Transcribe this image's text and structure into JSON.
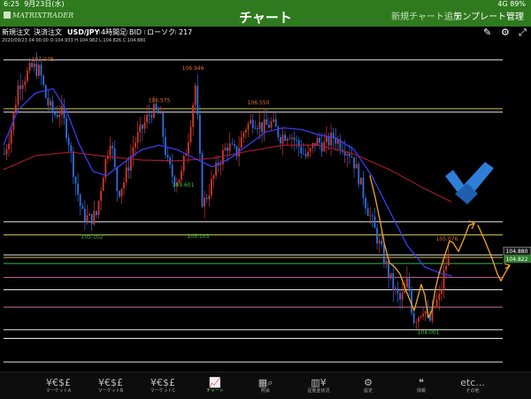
{
  "status_bar": {
    "time": "6:25",
    "date": "9月23日(水)",
    "right": "4G 89%"
  },
  "nav": {
    "logo": "MATRIXTRADER",
    "title": "チャート",
    "add_chart": "新規チャート追加",
    "template": "テンプレート管理"
  },
  "toolbar": {
    "new_order": "新規注文",
    "settle_order": "決済注文",
    "pair": "USD/JPY",
    "timeframe": "4時間足",
    "side": "BID",
    "chart_kind": "ローソク",
    "count": "217"
  },
  "ohlc_line": "2020/09/23 04:00:00   O:104.933  H:104.982  L:104.826  C:104.880",
  "tabs": [
    {
      "label": "マーケットA",
      "icon": "¥€$£"
    },
    {
      "label": "マーケットB",
      "icon": "¥€$£"
    },
    {
      "label": "マーケットC",
      "icon": "¥€$£"
    },
    {
      "label": "チャート",
      "icon": "chart"
    },
    {
      "label": "照会",
      "icon": "search"
    },
    {
      "label": "証拠金状況",
      "icon": "margin"
    },
    {
      "label": "設定",
      "icon": "gear"
    },
    {
      "label": "情報",
      "icon": "news"
    },
    {
      "label": "その他",
      "icon": "etc..."
    }
  ],
  "colors": {
    "up": "#d03a2c",
    "down": "#2f6fe0",
    "ma_short": "#3b3bf0",
    "ma_long": "#b01c2c",
    "hline_white": "#e6e6e6",
    "hline_yellow": "#c9c04a",
    "hline_pink": "#c46fa0",
    "price_tag": "#2e7d2e",
    "sketch": "#f2a71c",
    "annotation_blue": "#2f7fd8"
  },
  "chart_data": {
    "type": "candlestick",
    "symbol": "USD/JPY",
    "timeframe": "4時間足",
    "ylim": [
      103.55,
      107.25
    ],
    "high_low_labels": [
      {
        "text": "107.048",
        "x": 48,
        "price": 107.048
      },
      {
        "text": "106.946",
        "x": 218,
        "price": 106.946
      },
      {
        "text": "106.575",
        "x": 180,
        "price": 106.575
      },
      {
        "text": "106.550",
        "x": 292,
        "price": 106.55
      },
      {
        "text": "105.601",
        "x": 207,
        "price": 105.601
      },
      {
        "text": "105.102",
        "x": 104,
        "price": 105.102
      },
      {
        "text": "105.103",
        "x": 224,
        "price": 105.103
      },
      {
        "text": "105.076",
        "x": 505,
        "price": 105.076
      },
      {
        "text": "104.001",
        "x": 484,
        "price": 104.001
      }
    ],
    "current_price": "104.880",
    "bid_tag": "104.822",
    "horizontal_lines": [
      {
        "price": 107.08,
        "color": "white"
      },
      {
        "price": 106.52,
        "color": "yellow"
      },
      {
        "price": 106.48,
        "color": "white"
      },
      {
        "price": 105.22,
        "color": "white"
      },
      {
        "price": 105.07,
        "color": "yellow"
      },
      {
        "price": 104.84,
        "color": "white"
      },
      {
        "price": 104.81,
        "color": "yellow"
      },
      {
        "price": 104.74,
        "color": "green"
      },
      {
        "price": 104.58,
        "color": "pink"
      },
      {
        "price": 104.44,
        "color": "white"
      },
      {
        "price": 104.24,
        "color": "pink"
      },
      {
        "price": 103.98,
        "color": "white"
      },
      {
        "price": 103.88,
        "color": "white"
      },
      {
        "price": 103.61,
        "color": "white"
      }
    ],
    "candle_path": [
      [
        4,
        106.0
      ],
      [
        12,
        106.3
      ],
      [
        20,
        106.8
      ],
      [
        28,
        106.9
      ],
      [
        36,
        107.0
      ],
      [
        44,
        106.95
      ],
      [
        52,
        106.6
      ],
      [
        60,
        106.45
      ],
      [
        68,
        106.5
      ],
      [
        76,
        106.2
      ],
      [
        84,
        105.7
      ],
      [
        92,
        105.3
      ],
      [
        100,
        105.25
      ],
      [
        108,
        105.3
      ],
      [
        116,
        105.8
      ],
      [
        124,
        106.2
      ],
      [
        132,
        105.55
      ],
      [
        140,
        105.7
      ],
      [
        150,
        106.1
      ],
      [
        160,
        106.3
      ],
      [
        170,
        106.5
      ],
      [
        180,
        106.45
      ],
      [
        188,
        105.9
      ],
      [
        196,
        105.7
      ],
      [
        204,
        105.75
      ],
      [
        212,
        106.2
      ],
      [
        220,
        106.8
      ],
      [
        228,
        105.4
      ],
      [
        236,
        105.6
      ],
      [
        246,
        105.9
      ],
      [
        256,
        106.1
      ],
      [
        266,
        106.0
      ],
      [
        276,
        106.3
      ],
      [
        286,
        106.4
      ],
      [
        296,
        106.3
      ],
      [
        306,
        106.35
      ],
      [
        316,
        106.2
      ],
      [
        326,
        106.25
      ],
      [
        336,
        106.1
      ],
      [
        346,
        105.95
      ],
      [
        356,
        106.15
      ],
      [
        366,
        106.1
      ],
      [
        376,
        106.2
      ],
      [
        386,
        106.1
      ],
      [
        396,
        106.0
      ],
      [
        404,
        105.75
      ],
      [
        412,
        105.45
      ],
      [
        420,
        105.2
      ],
      [
        428,
        104.95
      ],
      [
        436,
        104.7
      ],
      [
        444,
        104.45
      ],
      [
        452,
        104.3
      ],
      [
        460,
        104.55
      ],
      [
        466,
        104.1
      ],
      [
        472,
        104.15
      ],
      [
        478,
        104.25
      ],
      [
        484,
        104.05
      ],
      [
        490,
        104.25
      ],
      [
        496,
        104.35
      ],
      [
        502,
        104.7
      ],
      [
        508,
        104.88
      ]
    ],
    "ma_short_path": [
      [
        4,
        106.1
      ],
      [
        20,
        106.5
      ],
      [
        40,
        106.7
      ],
      [
        60,
        106.75
      ],
      [
        75,
        106.5
      ],
      [
        90,
        106.1
      ],
      [
        105,
        105.8
      ],
      [
        120,
        105.75
      ],
      [
        140,
        105.9
      ],
      [
        160,
        106.05
      ],
      [
        180,
        106.1
      ],
      [
        200,
        106.05
      ],
      [
        220,
        105.95
      ],
      [
        240,
        105.85
      ],
      [
        260,
        105.95
      ],
      [
        280,
        106.1
      ],
      [
        300,
        106.25
      ],
      [
        320,
        106.3
      ],
      [
        340,
        106.28
      ],
      [
        360,
        106.22
      ],
      [
        380,
        106.18
      ],
      [
        400,
        106.05
      ],
      [
        420,
        105.75
      ],
      [
        440,
        105.35
      ],
      [
        460,
        104.95
      ],
      [
        480,
        104.7
      ],
      [
        500,
        104.62
      ],
      [
        510,
        104.6
      ]
    ],
    "ma_long_path": [
      [
        4,
        105.82
      ],
      [
        40,
        105.98
      ],
      [
        80,
        106.02
      ],
      [
        120,
        105.97
      ],
      [
        160,
        105.93
      ],
      [
        200,
        105.92
      ],
      [
        240,
        105.95
      ],
      [
        280,
        106.03
      ],
      [
        320,
        106.1
      ],
      [
        360,
        106.1
      ],
      [
        400,
        106.0
      ],
      [
        440,
        105.82
      ],
      [
        480,
        105.6
      ],
      [
        510,
        105.45
      ]
    ],
    "sketch_path": [
      [
        418,
        105.75
      ],
      [
        424,
        105.5
      ],
      [
        430,
        105.2
      ],
      [
        434,
        104.98
      ],
      [
        440,
        104.75
      ],
      [
        446,
        104.7
      ],
      [
        452,
        104.62
      ],
      [
        458,
        104.45
      ],
      [
        464,
        104.3
      ],
      [
        468,
        104.2
      ],
      [
        472,
        104.35
      ],
      [
        476,
        104.5
      ],
      [
        480,
        104.38
      ],
      [
        484,
        104.12
      ],
      [
        488,
        104.2
      ],
      [
        492,
        104.45
      ],
      [
        496,
        104.62
      ],
      [
        500,
        104.75
      ],
      [
        504,
        104.88
      ],
      [
        508,
        105.0
      ],
      [
        512,
        104.98
      ],
      [
        518,
        104.88
      ],
      [
        524,
        105.02
      ],
      [
        530,
        105.18
      ],
      [
        536,
        105.2
      ]
    ],
    "sketch_path2": [
      [
        540,
        105.18
      ],
      [
        548,
        105.0
      ],
      [
        556,
        104.8
      ],
      [
        562,
        104.62
      ],
      [
        566,
        104.54
      ],
      [
        570,
        104.62
      ],
      [
        576,
        104.72
      ]
    ]
  }
}
